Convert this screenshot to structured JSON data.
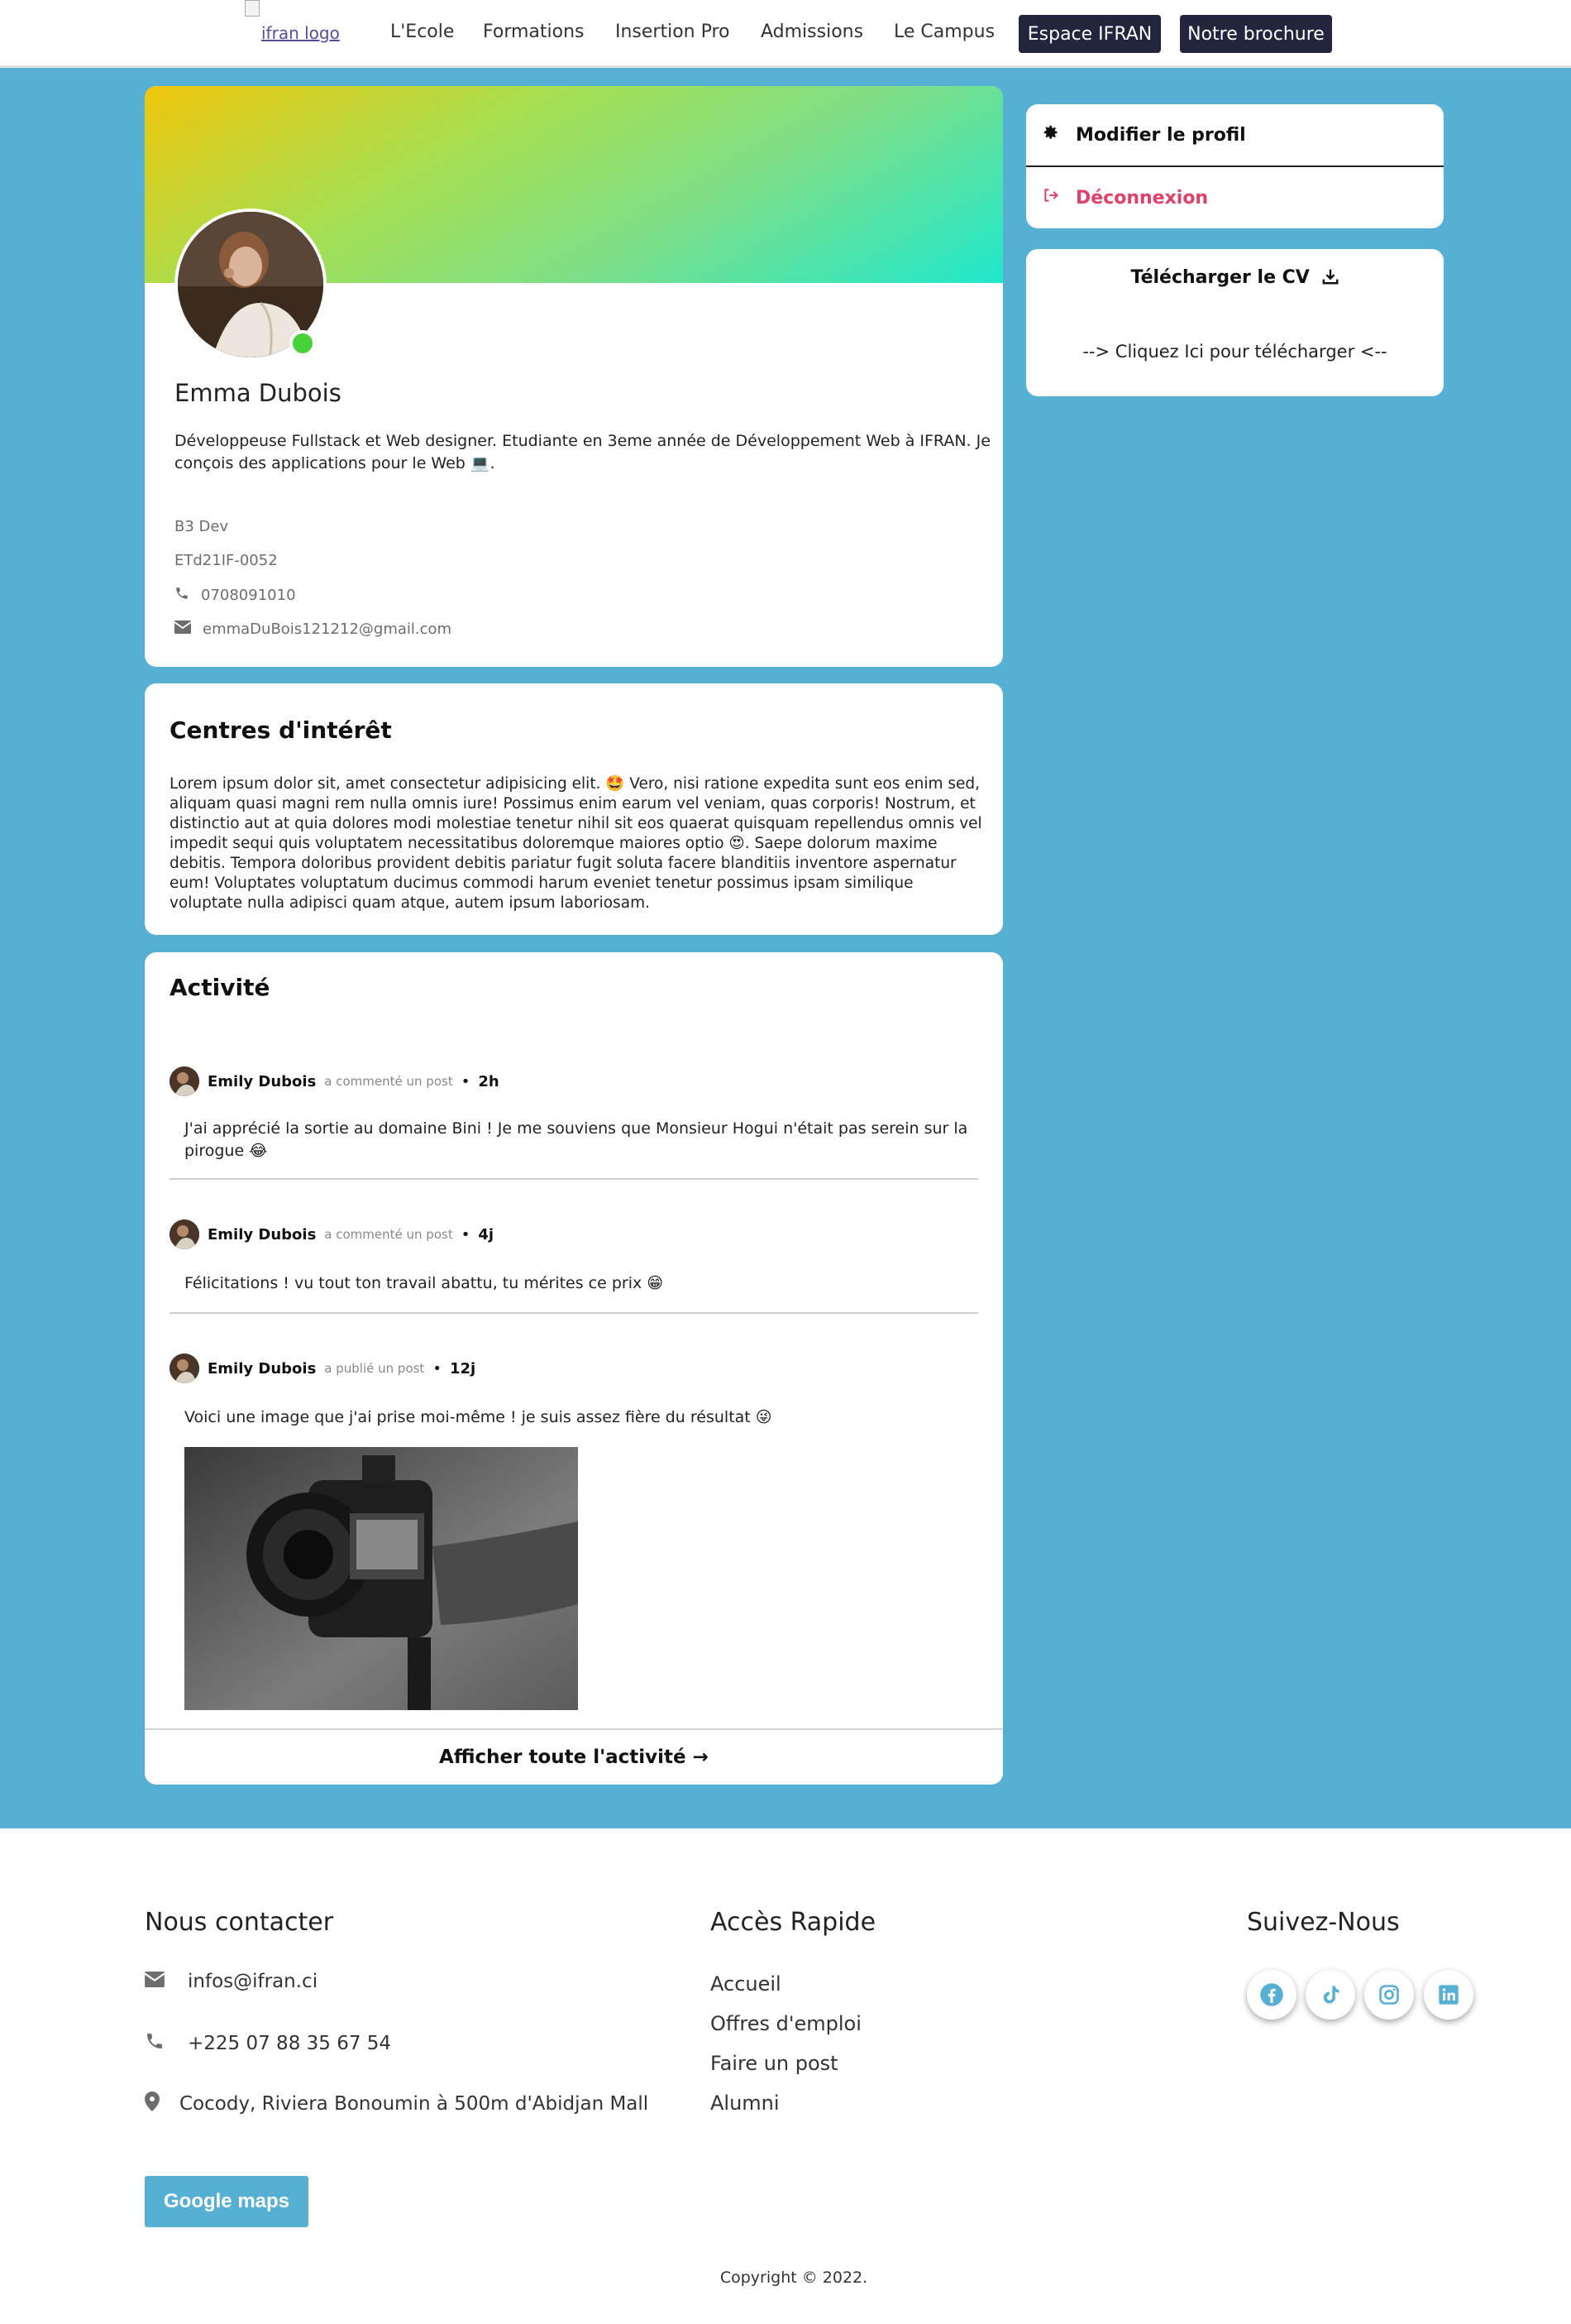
{
  "nav": {
    "logo_alt": "ifran logo",
    "links": [
      "L'Ecole",
      "Formations",
      "Insertion Pro",
      "Admissions",
      "Le Campus"
    ],
    "buttons": [
      "Espace IFRAN",
      "Notre brochure"
    ]
  },
  "profile": {
    "name": "Emma Dubois",
    "bio": "Développeuse Fullstack et Web designer. Etudiante en 3eme année de Développement Web à IFRAN. Je conçois des applications pour le Web 💻.",
    "level": "B3 Dev",
    "student_id": "ETd21IF-0052",
    "phone": "0708091010",
    "email": "emmaDuBois121212@gmail.com",
    "online": true
  },
  "interests": {
    "title": "Centres d'intérêt",
    "text": "Lorem ipsum dolor sit, amet consectetur adipisicing elit. 🤩 Vero, nisi ratione expedita sunt eos enim sed, aliquam quasi magni rem nulla omnis iure! Possimus enim earum vel veniam, quas corporis! Nostrum, et distinctio aut at quia dolores modi molestiae tenetur nihil sit eos quaerat quisquam repellendus omnis vel impedit sequi quis voluptatem necessitatibus doloremque maiores optio 😍. Saepe dolorum maxime debitis. Tempora doloribus provident debitis pariatur fugit soluta facere blanditiis inventore aspernatur eum! Voluptates voluptatum ducimus commodi harum eveniet tenetur possimus ipsam similique voluptate nulla adipisci quam atque, autem ipsum laboriosam."
  },
  "activity": {
    "title": "Activité",
    "items": [
      {
        "name": "Emily Dubois",
        "verb": "a commenté un post",
        "time": "2h",
        "text": "J'ai apprécié la sortie au domaine Bini ! Je me souviens que Monsieur Hogui n'était pas serein sur la pirogue 😂"
      },
      {
        "name": "Emily Dubois",
        "verb": "a commenté un post",
        "time": "4j",
        "text": "Félicitations ! vu tout ton travail abattu, tu mérites ce prix 😁"
      },
      {
        "name": "Emily Dubois",
        "verb": "a publié un post",
        "time": "12j",
        "text": "Voici une image que j'ai prise moi-même ! je suis assez fière du résultat 😜"
      }
    ],
    "footer": "Afficher toute l'activité →"
  },
  "sidebar": {
    "edit_profile": "Modifier le profil",
    "logout": "Déconnexion",
    "download_cv": "Télécharger le CV",
    "download_link": "--> Cliquez Ici pour télécharger <--"
  },
  "footer": {
    "contact_title": "Nous contacter",
    "email": "infos@ifran.ci",
    "phone": "+225 07 88 35 67 54",
    "address": "Cocody, Riviera Bonoumin à 500m d'Abidjan Mall",
    "quick_title": "Accès Rapide",
    "quick_links": [
      "Accueil",
      "Offres d'emploi",
      "Faire un post",
      "Alumni"
    ],
    "follow_title": "Suivez-Nous",
    "social": [
      "facebook-icon",
      "tiktok-icon",
      "instagram-icon",
      "linkedin-icon"
    ],
    "maps_button": "Google maps",
    "copyright": "Copyright © 2022."
  },
  "colors": {
    "accent_blue": "#56b0d4",
    "nav_button": "#23253f",
    "logout_red": "#e0406a",
    "online_green": "#47d23a"
  }
}
